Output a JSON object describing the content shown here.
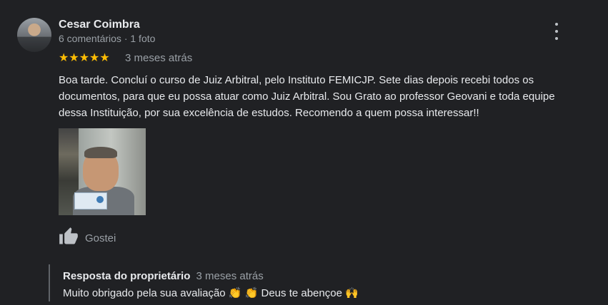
{
  "reviewer": {
    "name": "Cesar Coimbra",
    "meta": "6 comentários · 1 foto"
  },
  "rating": {
    "stars": "★★★★★",
    "value": 5,
    "time": "3 meses atrás"
  },
  "review": {
    "text": "Boa tarde. Concluí o curso de Juiz Arbitral, pelo Instituto FEMICJP. Sete dias depois recebi todos os documentos, para que eu possa atuar como Juiz Arbitral. Sou Grato ao professor Geovani e toda equipe dessa Instituição, por sua excelência de estudos. Recomendo a quem possa interessar!!"
  },
  "actions": {
    "like_label": "Gostei"
  },
  "owner_reply": {
    "title": "Resposta do proprietário",
    "time": "3 meses atrás",
    "text": "Muito obrigado pela sua avaliação 👏 👏 Deus te abençoe 🙌"
  },
  "colors": {
    "background": "#202124",
    "star": "#fbbc04",
    "text": "#e8eaed",
    "muted": "#9aa0a6"
  },
  "icons": [
    "avatar",
    "more-vert-icon",
    "star-icon",
    "thumb-up-icon"
  ]
}
